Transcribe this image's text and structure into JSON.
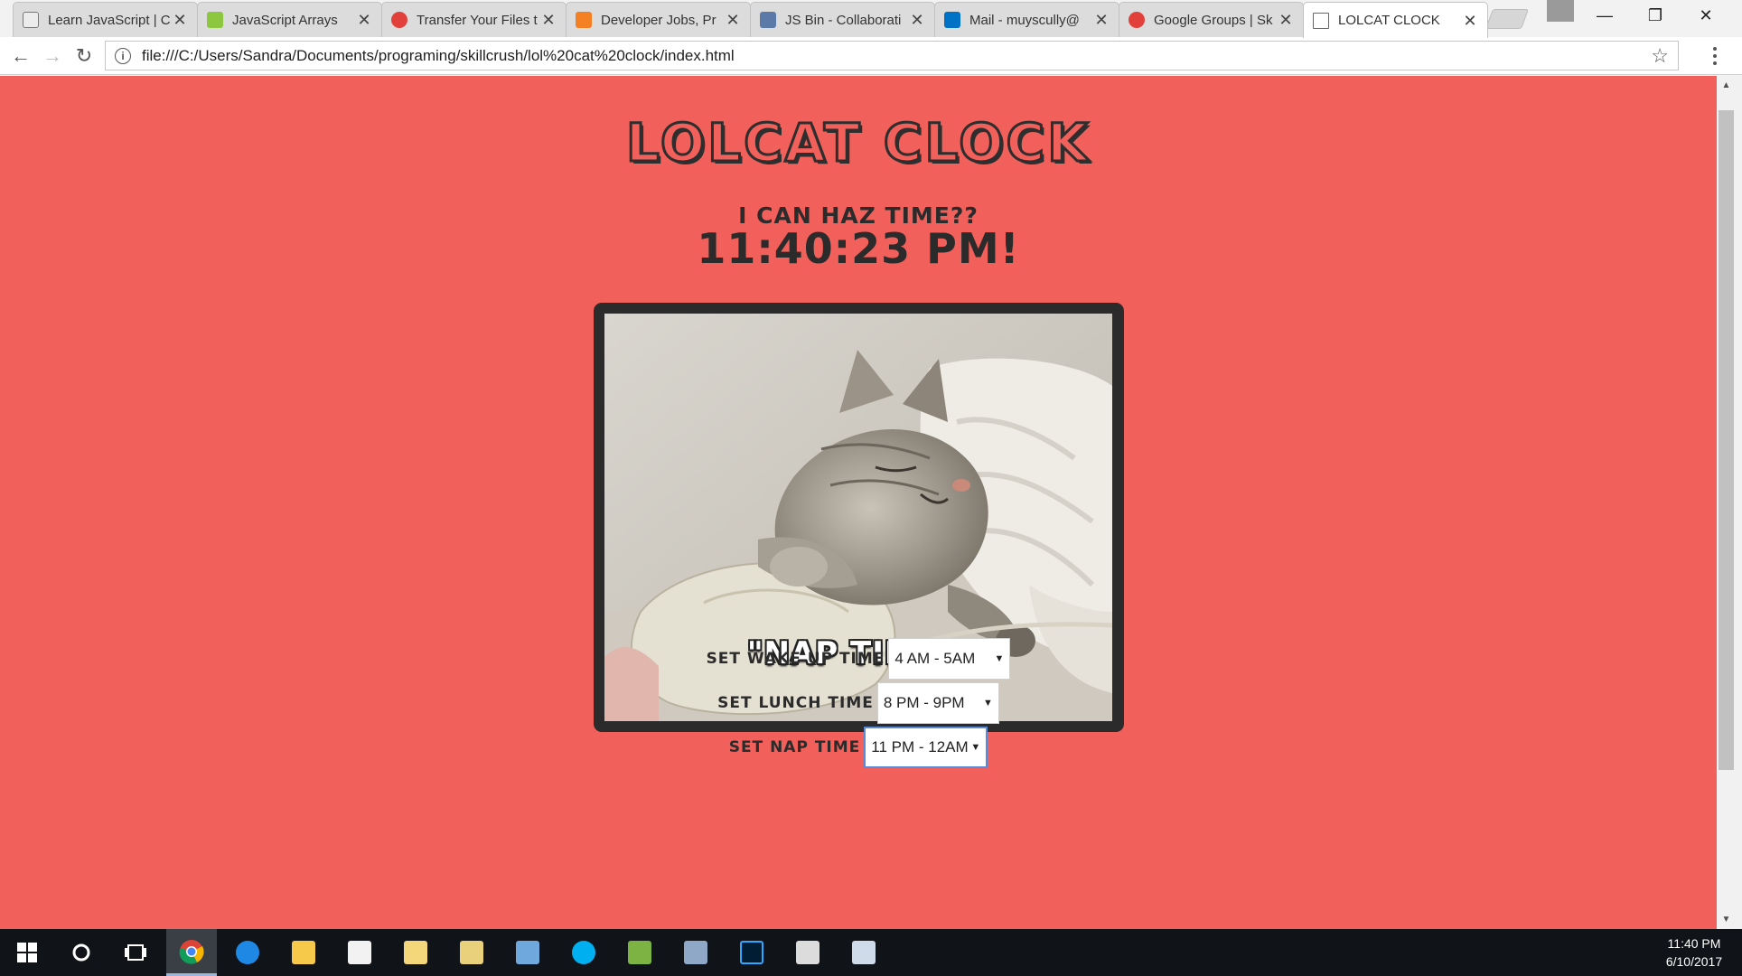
{
  "browser": {
    "tabs": [
      {
        "title": "Learn JavaScript | C",
        "favicon_color": "#6b6b6b",
        "active": false
      },
      {
        "title": "JavaScript Arrays",
        "favicon_color": "#8dc63f",
        "active": false
      },
      {
        "title": "Transfer Your Files t",
        "favicon_color": "#e2403a",
        "active": false
      },
      {
        "title": "Developer Jobs, Pr",
        "favicon_color": "#f48024",
        "active": false
      },
      {
        "title": "JS Bin - Collaborati",
        "favicon_color": "#5b7aa8",
        "active": false
      },
      {
        "title": "Mail - muyscully@",
        "favicon_color": "#0072c6",
        "active": false
      },
      {
        "title": "Google Groups | Sk",
        "favicon_color": "#e2403a",
        "active": false
      },
      {
        "title": "LOLCAT CLOCK",
        "favicon_color": "#ffffff",
        "active": true
      }
    ],
    "close_glyph": "✕",
    "window_controls": {
      "minimize": "—",
      "restore": "❐",
      "close": "✕"
    },
    "nav": {
      "back": "←",
      "forward": "→",
      "reload": "↻"
    },
    "address": "file:///C:/Users/Sandra/Documents/programing/skillcrush/lol%20cat%20clock/index.html",
    "info_glyph": "i",
    "star_glyph": "☆"
  },
  "page": {
    "title": "LOLCAT CLOCK",
    "subtitle": "I CAN HAZ TIME??",
    "clock": "11:40:23 PM!",
    "image_caption": "\"NAP TIME!\"",
    "controls": [
      {
        "label": "SET WAKE UP TIME",
        "value": "4 AM - 5AM"
      },
      {
        "label": "SET LUNCH TIME",
        "value": "8 PM - 9PM"
      },
      {
        "label": "SET NAP TIME",
        "value": "11 PM - 12AM"
      }
    ],
    "caret": "▼",
    "background_color": "#f1605a"
  },
  "taskbar": {
    "icons": [
      "windows-start-icon",
      "cortana-icon",
      "task-view-icon",
      "chrome-icon",
      "edge-icon",
      "file-explorer-icon",
      "store-icon",
      "documents-icon",
      "files-icon",
      "contacts-icon",
      "skype-icon",
      "spreadsheet-icon",
      "laptop-icon",
      "photoshop-icon",
      "calculator-icon",
      "viewer-icon"
    ],
    "time": "11:40 PM",
    "date": "6/10/2017"
  }
}
